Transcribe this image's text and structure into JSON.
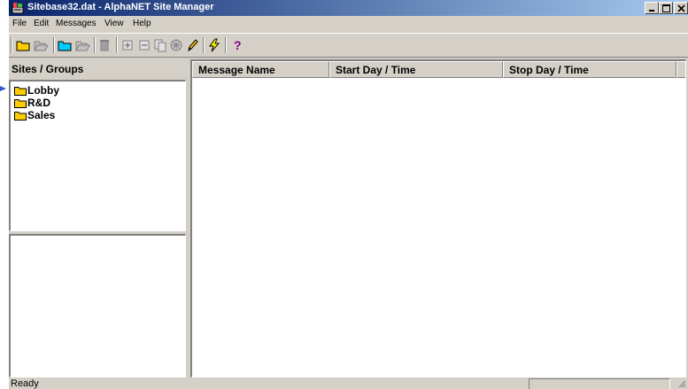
{
  "window": {
    "title": "Sitebase32.dat - AlphaNET Site Manager",
    "controls": [
      "minimize",
      "maximize",
      "close"
    ]
  },
  "menu": {
    "items": [
      "File",
      "Edit",
      "Messages",
      "View",
      "Help"
    ]
  },
  "toolbar": {
    "icons": [
      "new-folder-icon",
      "open-folder-icon",
      "new-site-icon",
      "open-site-icon",
      "delete-icon",
      "add-icon",
      "remove-icon",
      "copy-icon",
      "network-icon",
      "pencil-icon",
      "lightning-icon",
      "help-icon"
    ]
  },
  "sites_pane": {
    "header": "Sites / Groups",
    "items": [
      "Lobby",
      "R&D",
      "Sales"
    ]
  },
  "messages": {
    "columns": [
      "Message Name",
      "Start Day / Time",
      "Stop Day / Time"
    ]
  },
  "status": {
    "text": "Ready"
  },
  "colors": {
    "titlebar_start": "#0a246a",
    "titlebar_end": "#a6caf0",
    "face": "#d4d0c8",
    "folder": "#ffcc00"
  }
}
